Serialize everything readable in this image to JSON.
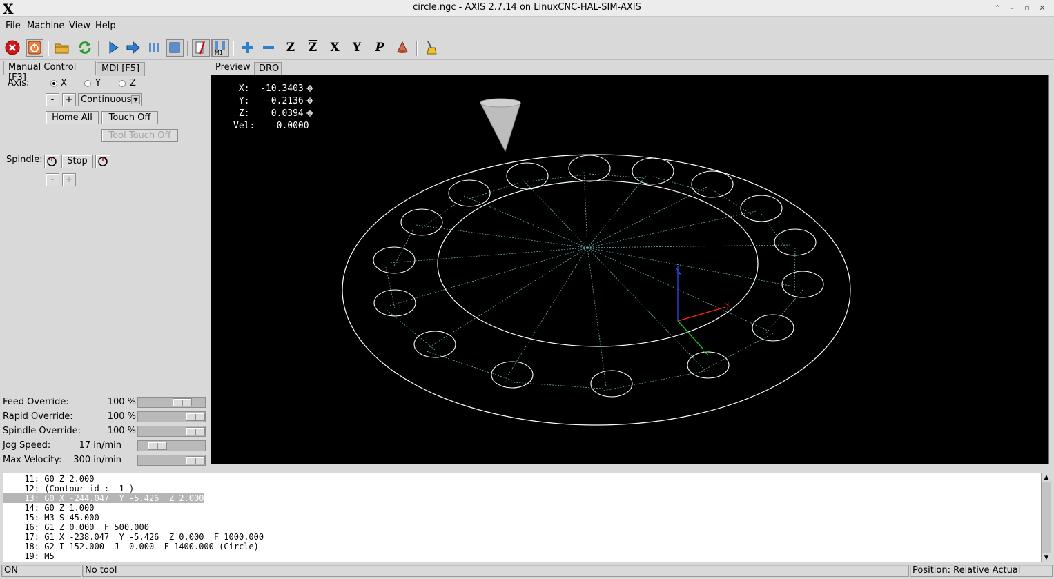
{
  "window": {
    "title": "circle.ngc - AXIS 2.7.14 on LinuxCNC-HAL-SIM-AXIS",
    "logo": "X"
  },
  "menu": {
    "items": [
      "File",
      "Machine",
      "View",
      "Help"
    ]
  },
  "toolbar": {
    "buttons": [
      {
        "name": "estop-icon",
        "pressed": false
      },
      {
        "name": "machine-power-icon",
        "pressed": true
      },
      {
        "name": "open-file-icon",
        "pressed": false
      },
      {
        "name": "reload-icon",
        "pressed": false
      },
      {
        "name": "run-icon",
        "pressed": false
      },
      {
        "name": "step-icon",
        "pressed": false
      },
      {
        "name": "pause-icon",
        "pressed": false
      },
      {
        "name": "stop-icon",
        "pressed": true
      },
      {
        "name": "block-delete-icon",
        "pressed": true
      },
      {
        "name": "optional-stop-icon",
        "pressed": true
      },
      {
        "name": "zoom-in-icon",
        "pressed": false
      },
      {
        "name": "zoom-out-icon",
        "pressed": false
      },
      {
        "name": "view-z-icon",
        "pressed": false,
        "label": "Z"
      },
      {
        "name": "view-z2-icon",
        "pressed": false,
        "label": "Z"
      },
      {
        "name": "view-x-icon",
        "pressed": false,
        "label": "X"
      },
      {
        "name": "view-y-icon",
        "pressed": false,
        "label": "Y"
      },
      {
        "name": "view-p-icon",
        "pressed": false,
        "label": "P"
      },
      {
        "name": "backplot-toggle-icon",
        "pressed": false
      },
      {
        "name": "clear-backplot-icon",
        "pressed": false
      }
    ]
  },
  "left_tabs": [
    "Manual Control [F3]",
    "MDI [F5]"
  ],
  "manual": {
    "axis_label": "Axis:",
    "axes": [
      {
        "label": "X",
        "selected": true
      },
      {
        "label": "Y",
        "selected": false
      },
      {
        "label": "Z",
        "selected": false
      }
    ],
    "jog_minus": "-",
    "jog_plus": "+",
    "jog_mode": "Continuous",
    "home_all": "Home All",
    "touch_off": "Touch Off",
    "tool_touch_off": "Tool Touch Off",
    "spindle_label": "Spindle:",
    "spindle_stop": "Stop",
    "spindle_minus": "-",
    "spindle_plus": "+"
  },
  "overrides": [
    {
      "label": "Feed Override:",
      "value": "100 %",
      "fraction": 0.72
    },
    {
      "label": "Rapid Override:",
      "value": "100 %",
      "fraction": 1.0
    },
    {
      "label": "Spindle Override:",
      "value": "100 %",
      "fraction": 1.0
    },
    {
      "label": "Jog Speed:",
      "value": "17 in/min",
      "fraction": 0.2
    },
    {
      "label": "Max Velocity:",
      "value": "300 in/min",
      "fraction": 1.0
    }
  ],
  "view_tabs": [
    "Preview",
    "DRO"
  ],
  "dro": {
    "x": " X:  -10.3403",
    "y": " Y:   -0.2136",
    "z": " Z:    0.0394",
    "vel": "Vel:    0.0000"
  },
  "code_lines": [
    {
      "num": "11:",
      "text": " G0 Z 2.000",
      "selected": false
    },
    {
      "num": "12:",
      "text": " (Contour id :  1 )",
      "selected": false
    },
    {
      "num": "13:",
      "text": " G0 X -244.047  Y -5.426  Z 2.000",
      "selected": true
    },
    {
      "num": "14:",
      "text": " G0 Z 1.000",
      "selected": false
    },
    {
      "num": "15:",
      "text": " M3 S 45.000",
      "selected": false
    },
    {
      "num": "16:",
      "text": " G1 Z 0.000  F 500.000",
      "selected": false
    },
    {
      "num": "17:",
      "text": " G1 X -238.047  Y -5.426  Z 0.000  F 1000.000",
      "selected": false
    },
    {
      "num": "18:",
      "text": " G2 I 152.000  J  0.000  F 1400.000 (Circle)",
      "selected": false
    },
    {
      "num": "19:",
      "text": " M5",
      "selected": false
    }
  ],
  "status": {
    "machine": "ON",
    "tool": "No tool",
    "position": "Position: Relative Actual"
  },
  "colors": {
    "preview_bg": "#000000",
    "toolpath": "#ffffff",
    "rapid": "#6fb0b0",
    "axis_x": "#ff2020",
    "axis_y": "#20c020",
    "axis_z": "#3050ff"
  }
}
